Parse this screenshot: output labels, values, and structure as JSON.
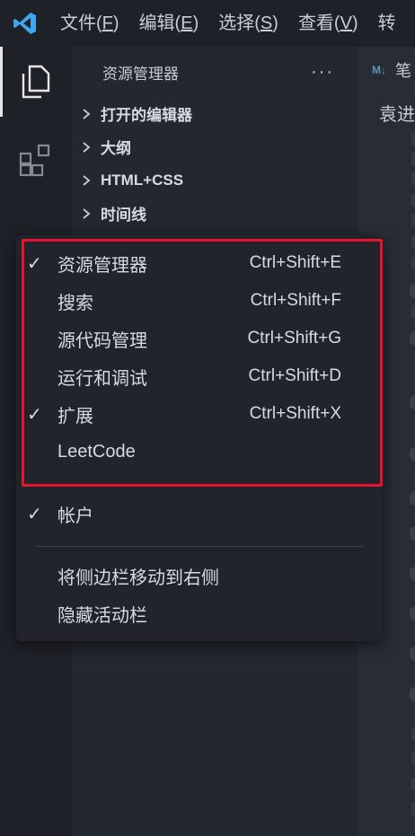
{
  "titlebar": {
    "menus": [
      {
        "label": "文件(",
        "key": "F",
        "end": ")"
      },
      {
        "label": "编辑(",
        "key": "E",
        "end": ")"
      },
      {
        "label": "选择(",
        "key": "S",
        "end": ")"
      },
      {
        "label": "查看(",
        "key": "V",
        "end": ")"
      },
      {
        "label": "转"
      }
    ]
  },
  "activitybar": {
    "icons": [
      "files-icon",
      "extensions-icon"
    ]
  },
  "sidebar": {
    "title": "资源管理器",
    "more": "···",
    "sections": [
      "打开的编辑器",
      "大纲",
      "HTML+CSS",
      "时间线"
    ]
  },
  "editor": {
    "tab_badge": "M↓",
    "tab_label": "笔",
    "breadcrumb": "袁进"
  },
  "context_menu": {
    "items": [
      {
        "label": "资源管理器",
        "shortcut": "Ctrl+Shift+E",
        "checked": true
      },
      {
        "label": "搜索",
        "shortcut": "Ctrl+Shift+F",
        "checked": false
      },
      {
        "label": "源代码管理",
        "shortcut": "Ctrl+Shift+G",
        "checked": false
      },
      {
        "label": "运行和调试",
        "shortcut": "Ctrl+Shift+D",
        "checked": false
      },
      {
        "label": "扩展",
        "shortcut": "Ctrl+Shift+X",
        "checked": true
      },
      {
        "label": "LeetCode",
        "shortcut": "",
        "checked": false
      }
    ],
    "accounts": {
      "label": "帐户",
      "checked": true
    },
    "actions": [
      "将侧边栏移动到右侧",
      "隐藏活动栏"
    ],
    "check_glyph": "✓"
  },
  "colors": {
    "accent": "#e8132c",
    "vscode_blue": "#3ea6f0",
    "markdown_badge": "#519aba"
  }
}
